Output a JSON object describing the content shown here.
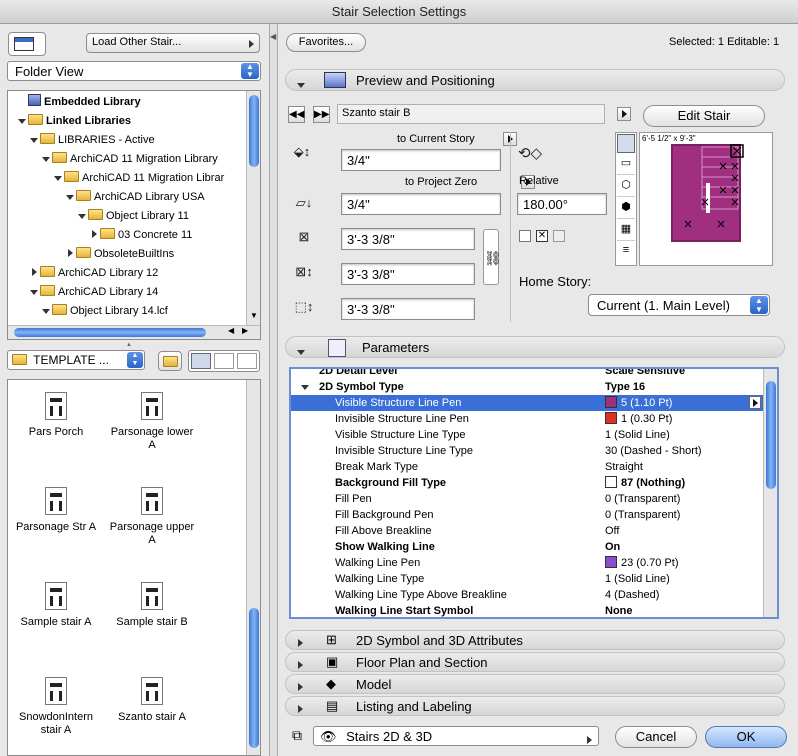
{
  "window": {
    "title": "Stair Selection Settings"
  },
  "left": {
    "load_other": "Load Other Stair...",
    "folder_view": "Folder View",
    "tree": [
      {
        "label": "Embedded Library",
        "bold": true,
        "toggle": "",
        "icon": "library"
      },
      {
        "label": "Linked Libraries",
        "bold": true,
        "toggle": "down",
        "icon": "folder"
      },
      {
        "label": "LIBRARIES - Active",
        "bold": false,
        "toggle": "down",
        "icon": "folder"
      },
      {
        "label": "ArchiCAD 11 Migration Library",
        "bold": false,
        "toggle": "down",
        "icon": "folder"
      },
      {
        "label": "ArchiCAD 11 Migration Librar",
        "bold": false,
        "toggle": "down",
        "icon": "folder"
      },
      {
        "label": "ArchiCAD Library USA",
        "bold": false,
        "toggle": "down",
        "icon": "folder"
      },
      {
        "label": "Object Library 11",
        "bold": false,
        "toggle": "down",
        "icon": "folder"
      },
      {
        "label": "03 Concrete 11",
        "bold": false,
        "toggle": "right",
        "icon": "folder"
      },
      {
        "label": "ObsoleteBuiltIns",
        "bold": false,
        "toggle": "right",
        "icon": "folder"
      },
      {
        "label": "ArchiCAD Library 12",
        "bold": false,
        "toggle": "right",
        "icon": "folder"
      },
      {
        "label": "ArchiCAD Library 14",
        "bold": false,
        "toggle": "down",
        "icon": "folder"
      },
      {
        "label": "Object Library 14.lcf",
        "bold": false,
        "toggle": "down",
        "icon": "folder"
      }
    ],
    "template_label": "TEMPLATE ...",
    "items": [
      {
        "label": "Pars Porch"
      },
      {
        "label": "Parsonage lower A"
      },
      {
        "label": "Parsonage Str A"
      },
      {
        "label": "Parsonage upper A"
      },
      {
        "label": "Sample stair A"
      },
      {
        "label": "Sample stair B"
      },
      {
        "label": "SnowdonIntern stair A"
      },
      {
        "label": "Szanto stair A"
      }
    ]
  },
  "right": {
    "favorites": "Favorites...",
    "selected_info": "Selected: 1 Editable: 1",
    "preview_title": "Preview and Positioning",
    "stair_name": "Szanto stair B",
    "edit_stair": "Edit Stair",
    "to_current_story": "to Current Story",
    "to_project_zero": "to Project Zero",
    "offset_current": "3/4\"",
    "offset_zero": "3/4\"",
    "dim_x": "3'-3 3/8\"",
    "dim_y": "3'-3 3/8\"",
    "dim_z": "3'-3 3/8\"",
    "relative": "Relative",
    "angle": "180.00°",
    "preview_dims": "6'-5 1/2\" x 9'-3\"",
    "home_story_label": "Home Story:",
    "home_story_value": "Current (1. Main Level)",
    "parameters_title": "Parameters",
    "params": [
      {
        "name": "2D Detail Level",
        "value": "Scale Sensitive",
        "indent": 1,
        "bold": true,
        "toggle": "",
        "swatch": ""
      },
      {
        "name": "2D Symbol Type",
        "value": "Type 16",
        "indent": 1,
        "bold": true,
        "toggle": "down",
        "swatch": ""
      },
      {
        "name": "Visible Structure Line Pen",
        "value": "5 (1.10 Pt)",
        "indent": 2,
        "bold": false,
        "toggle": "",
        "swatch": "#a0307f",
        "selected": true
      },
      {
        "name": "Invisible Structure Line Pen",
        "value": "1 (0.30 Pt)",
        "indent": 2,
        "bold": false,
        "toggle": "",
        "swatch": "#e03020"
      },
      {
        "name": "Visible Structure Line Type",
        "value": "1 (Solid Line)",
        "indent": 2,
        "bold": false,
        "toggle": "",
        "swatch": ""
      },
      {
        "name": "Invisible Structure Line Type",
        "value": "30 (Dashed - Short)",
        "indent": 2,
        "bold": false,
        "toggle": "",
        "swatch": ""
      },
      {
        "name": "Break Mark Type",
        "value": "Straight",
        "indent": 2,
        "bold": false,
        "toggle": "",
        "swatch": ""
      },
      {
        "name": "Background Fill Type",
        "value": "87 (Nothing)",
        "indent": 2,
        "bold": true,
        "toggle": "",
        "swatch": "#ffffff"
      },
      {
        "name": "Fill Pen",
        "value": "0 (Transparent)",
        "indent": 2,
        "bold": false,
        "toggle": "",
        "swatch": ""
      },
      {
        "name": "Fill Background Pen",
        "value": "0 (Transparent)",
        "indent": 2,
        "bold": false,
        "toggle": "",
        "swatch": ""
      },
      {
        "name": "Fill Above Breakline",
        "value": "Off",
        "indent": 2,
        "bold": false,
        "toggle": "",
        "swatch": ""
      },
      {
        "name": "Show Walking Line",
        "value": "On",
        "indent": 2,
        "bold": true,
        "toggle": "",
        "swatch": ""
      },
      {
        "name": "Walking Line Pen",
        "value": "23 (0.70 Pt)",
        "indent": 2,
        "bold": false,
        "toggle": "",
        "swatch": "#8a4fd0"
      },
      {
        "name": "Walking Line Type",
        "value": "1 (Solid Line)",
        "indent": 2,
        "bold": false,
        "toggle": "",
        "swatch": ""
      },
      {
        "name": "Walking Line Type Above Breakline",
        "value": "4 (Dashed)",
        "indent": 2,
        "bold": false,
        "toggle": "",
        "swatch": ""
      },
      {
        "name": "Walking Line Start Symbol",
        "value": "None",
        "indent": 2,
        "bold": true,
        "toggle": "",
        "swatch": ""
      }
    ],
    "sections": [
      {
        "title": "2D Symbol and 3D Attributes"
      },
      {
        "title": "Floor Plan and Section"
      },
      {
        "title": "Model"
      },
      {
        "title": "Listing and Labeling"
      }
    ],
    "layer": "Stairs 2D & 3D",
    "cancel": "Cancel",
    "ok": "OK"
  },
  "colors": {
    "accent": "#3a6fd8",
    "stair_fill": "#a0307f"
  }
}
